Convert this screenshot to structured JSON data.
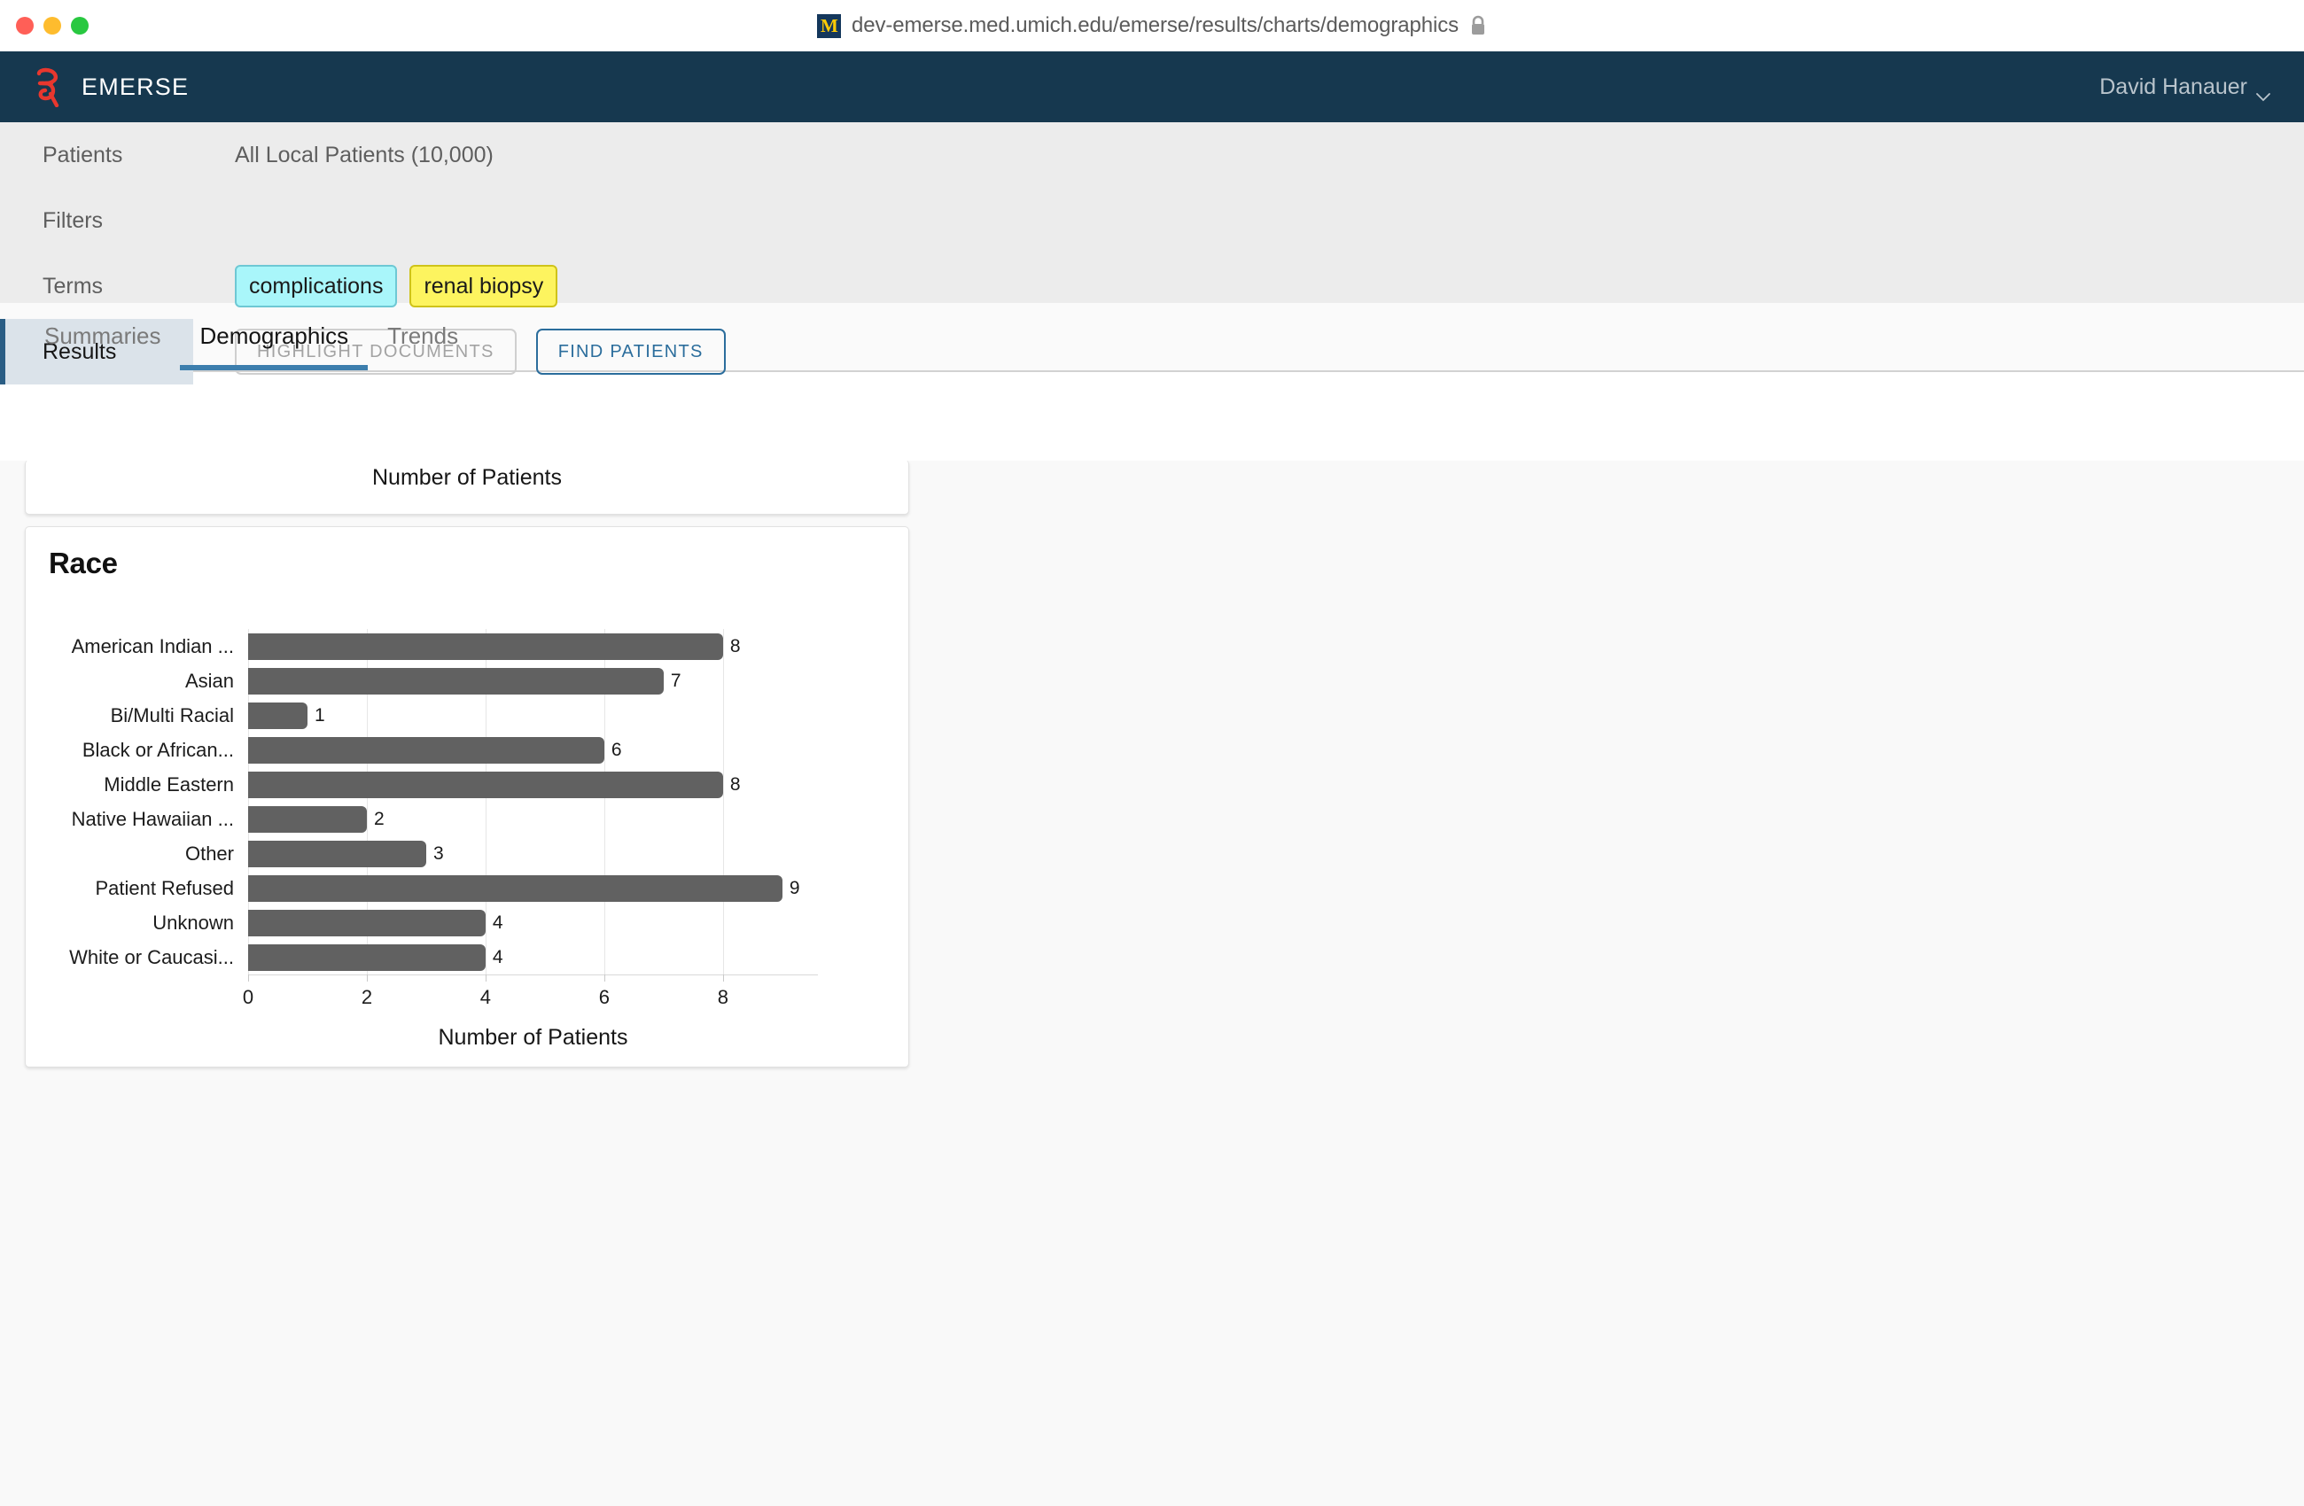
{
  "browser": {
    "url": "dev-emerse.med.umich.edu/emerse/results/charts/demographics",
    "favicon_letter": "M",
    "lock_icon": "lock-icon",
    "traffic_lights": [
      "close",
      "minimize",
      "maximize"
    ]
  },
  "header": {
    "brand_name": "EMERSE",
    "brand_mark": "emerse-logo-icon",
    "user_name": "David Hanauer",
    "user_chevron": "chevron-down-icon",
    "bg_color": "#16384f"
  },
  "criteria": {
    "nav_items": [
      {
        "label": "Patients",
        "active": false
      },
      {
        "label": "Filters",
        "active": false
      },
      {
        "label": "Terms",
        "active": false
      },
      {
        "label": "Results",
        "active": true
      }
    ],
    "patients_value": "All Local Patients (10,000)",
    "terms": [
      {
        "label": "complications",
        "color": "#a9f6fa"
      },
      {
        "label": "renal biopsy",
        "color": "#fdf45f"
      }
    ],
    "buttons": [
      {
        "label": "HIGHLIGHT DOCUMENTS",
        "state": "disabled"
      },
      {
        "label": "FIND PATIENTS",
        "state": "primary"
      }
    ]
  },
  "tabs": [
    {
      "label": "Summaries",
      "active": false
    },
    {
      "label": "Demographics",
      "active": true
    },
    {
      "label": "Trends",
      "active": false
    }
  ],
  "cards": {
    "top_partial_axis_label": "Number of Patients"
  },
  "chart_data": {
    "type": "bar",
    "orientation": "horizontal",
    "title": "Race",
    "xlabel": "Number of Patients",
    "ylabel": "",
    "xlim": [
      0,
      9.6
    ],
    "xticks": [
      0,
      2,
      4,
      6,
      8
    ],
    "grid": true,
    "legend": null,
    "bar_color": "#616161",
    "categories": [
      "American Indian ...",
      "Asian",
      "Bi/Multi Racial",
      "Black or African...",
      "Middle Eastern",
      "Native Hawaiian ...",
      "Other",
      "Patient Refused",
      "Unknown",
      "White or Caucasi..."
    ],
    "values": [
      8,
      7,
      1,
      6,
      8,
      2,
      3,
      9,
      4,
      4
    ],
    "value_labels": [
      "8",
      "7",
      "1",
      "6",
      "8",
      "2",
      "3",
      "9",
      "4",
      "4"
    ]
  }
}
